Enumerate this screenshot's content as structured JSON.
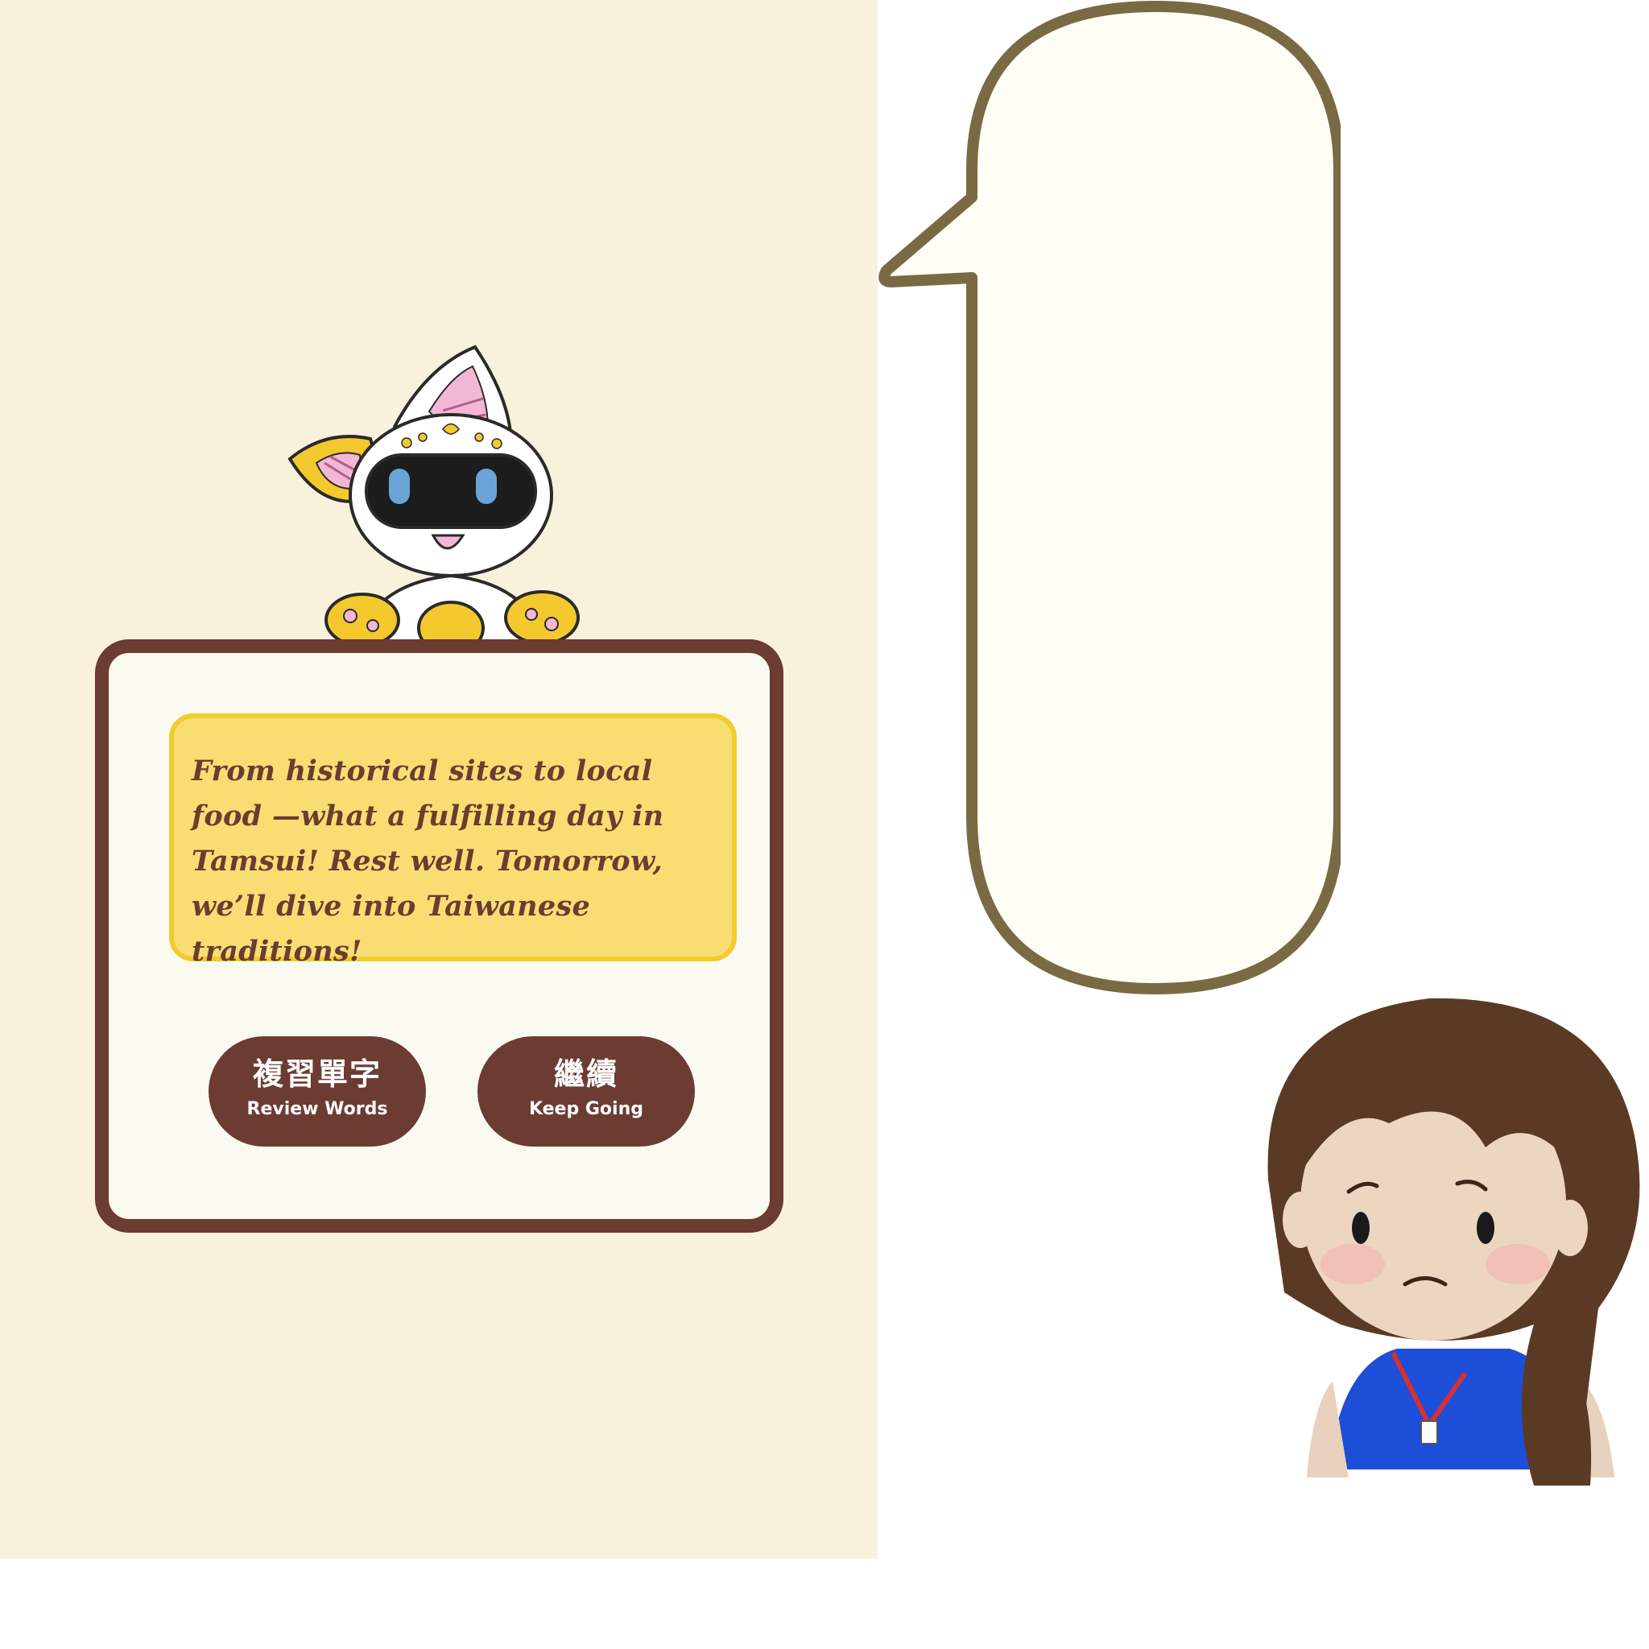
{
  "dialog": {
    "message": "From historical sites to local food —what a fulfilling day in Tamsui! Rest well. Tomorrow, we’ll dive into Taiwanese traditions!"
  },
  "buttons": {
    "review": {
      "label_zh": "複習單字",
      "label_en": "Review Words"
    },
    "continue": {
      "label_zh": "繼續",
      "label_en": "Keep Going"
    }
  },
  "colors": {
    "panel_background": "#f8f2dd",
    "card_border": "#6c3b32",
    "message_fill": "#f8de72",
    "message_border": "#f2cb2c",
    "button_fill": "#6c3b32",
    "bubble_border": "#7a6a43"
  },
  "illustrations": {
    "mascot": "robot-cat-mascot",
    "speaker": "girl-character",
    "speech_bubble": "empty-speech-bubble"
  }
}
